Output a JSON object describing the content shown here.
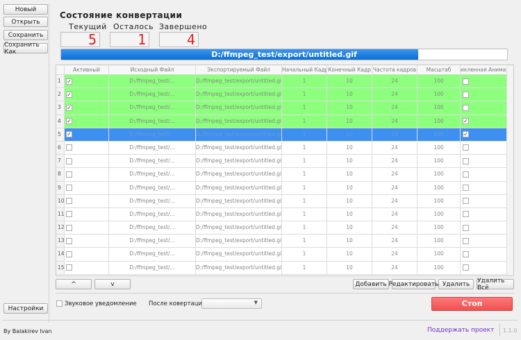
{
  "sidebar": {
    "new": "Новый",
    "open": "Открыть",
    "save": "Сохранить",
    "save_as": "Сохранить Как",
    "settings": "Настройки"
  },
  "status": {
    "title": "Состояние конвертации",
    "current_label": "Текущий",
    "current": "5",
    "remaining_label": "Осталось",
    "remaining": "1",
    "done_label": "Завершено",
    "done": "4"
  },
  "progress": {
    "text": "D:/ffmpeg_test/export/untitled.gif",
    "percent": 80,
    "color": "#1a7fe0"
  },
  "table": {
    "columns": [
      "Активный",
      "Исходный Файл",
      "Экспортируемый Файл",
      "Начальный Кадр",
      "Конечный Кадр",
      "Частота кадров",
      "Масштаб",
      "икленная Анимац"
    ],
    "rows": [
      {
        "n": "1",
        "active": true,
        "src": "D:/ffmpeg_test/...",
        "dst": "D:/ffmpeg_test/export/untitled.gif",
        "start": "1",
        "end": "10",
        "fps": "24",
        "scale": "100",
        "loop": false,
        "state": "done"
      },
      {
        "n": "2",
        "active": true,
        "src": "D:/ffmpeg_test/...",
        "dst": "D:/ffmpeg_test/export/untitled.gif",
        "start": "1",
        "end": "10",
        "fps": "24",
        "scale": "100",
        "loop": false,
        "state": "done"
      },
      {
        "n": "3",
        "active": true,
        "src": "D:/ffmpeg_test/...",
        "dst": "D:/ffmpeg_test/export/untitled.gif",
        "start": "1",
        "end": "10",
        "fps": "24",
        "scale": "100",
        "loop": false,
        "state": "done"
      },
      {
        "n": "4",
        "active": true,
        "src": "D:/ffmpeg_test/...",
        "dst": "D:/ffmpeg_test/export/untitled.gif",
        "start": "1",
        "end": "10",
        "fps": "24",
        "scale": "100",
        "loop": true,
        "state": "done"
      },
      {
        "n": "5",
        "active": true,
        "src": "D:/ffmpeg_test/...",
        "dst": "D:/ffmpeg_test/export/untitled.gif",
        "start": "1",
        "end": "10",
        "fps": "24",
        "scale": "100",
        "loop": true,
        "state": "selected"
      },
      {
        "n": "6",
        "active": false,
        "src": "D:/ffmpeg_test/...",
        "dst": "D:/ffmpeg_test/export/untitled.gif",
        "start": "1",
        "end": "10",
        "fps": "24",
        "scale": "100",
        "loop": false,
        "state": ""
      },
      {
        "n": "7",
        "active": false,
        "src": "D:/ffmpeg_test/...",
        "dst": "D:/ffmpeg_test/export/untitled.gif",
        "start": "1",
        "end": "10",
        "fps": "24",
        "scale": "100",
        "loop": false,
        "state": ""
      },
      {
        "n": "8",
        "active": false,
        "src": "D:/ffmpeg_test/...",
        "dst": "D:/ffmpeg_test/export/untitled.gif",
        "start": "1",
        "end": "10",
        "fps": "24",
        "scale": "100",
        "loop": false,
        "state": ""
      },
      {
        "n": "9",
        "active": false,
        "src": "D:/ffmpeg_test/...",
        "dst": "D:/ffmpeg_test/export/untitled.gif",
        "start": "1",
        "end": "10",
        "fps": "24",
        "scale": "100",
        "loop": false,
        "state": ""
      },
      {
        "n": "10",
        "active": false,
        "src": "D:/ffmpeg_test/...",
        "dst": "D:/ffmpeg_test/export/untitled.gif",
        "start": "1",
        "end": "10",
        "fps": "24",
        "scale": "100",
        "loop": false,
        "state": ""
      },
      {
        "n": "11",
        "active": false,
        "src": "D:/ffmpeg_test/...",
        "dst": "D:/ffmpeg_test/export/untitled.gif",
        "start": "1",
        "end": "10",
        "fps": "24",
        "scale": "100",
        "loop": false,
        "state": ""
      },
      {
        "n": "12",
        "active": false,
        "src": "D:/ffmpeg_test/...",
        "dst": "D:/ffmpeg_test/export/untitled.gif",
        "start": "1",
        "end": "10",
        "fps": "24",
        "scale": "100",
        "loop": false,
        "state": ""
      },
      {
        "n": "13",
        "active": false,
        "src": "D:/ffmpeg_test/...",
        "dst": "D:/ffmpeg_test/export/untitled.gif",
        "start": "1",
        "end": "10",
        "fps": "24",
        "scale": "100",
        "loop": false,
        "state": ""
      },
      {
        "n": "14",
        "active": false,
        "src": "D:/ffmpeg_test/...",
        "dst": "D:/ffmpeg_test/export/untitled.gif",
        "start": "1",
        "end": "10",
        "fps": "24",
        "scale": "100",
        "loop": false,
        "state": ""
      },
      {
        "n": "15",
        "active": false,
        "src": "D:/ffmpeg_test/...",
        "dst": "D:/ffmpeg_test/export/untitled.gif",
        "start": "1",
        "end": "10",
        "fps": "24",
        "scale": "100",
        "loop": false,
        "state": ""
      }
    ]
  },
  "actions": {
    "up": "^",
    "down": "v",
    "add": "Добавить",
    "edit": "Редактировать",
    "delete": "Удалить",
    "delete_all": "Удалить Всё"
  },
  "options": {
    "sound": "Звуковое уведомление",
    "sound_checked": false,
    "after_label": "После ковертации:",
    "after_value": ""
  },
  "stop": "Стоп",
  "footer": {
    "author": "By Balakirev Ivan",
    "support": "Поддержать проект",
    "version": "1.1.0"
  }
}
